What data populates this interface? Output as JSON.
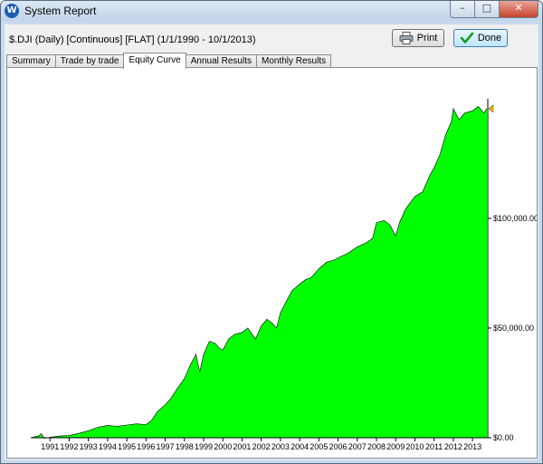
{
  "window": {
    "title": "System Report",
    "app_icon": "W",
    "controls": {
      "minimize": "–",
      "maximize": "□",
      "close": "✕"
    }
  },
  "header": {
    "subtitle": "$.DJI (Daily) [Continuous] [FLAT]  (1/1/1990 - 10/1/2013)"
  },
  "toolbar": {
    "print_label": "Print",
    "done_label": "Done"
  },
  "tabs": [
    {
      "label": "Summary"
    },
    {
      "label": "Trade by trade"
    },
    {
      "label": "Equity Curve",
      "active": true
    },
    {
      "label": "Annual Results"
    },
    {
      "label": "Monthly Results"
    }
  ],
  "colors": {
    "fill": "#00ff00",
    "outline": "#000000",
    "marker": "#e0c000"
  },
  "chart_data": {
    "type": "area",
    "x_ticks": [
      "1991",
      "1992",
      "1993",
      "1994",
      "1995",
      "1996",
      "1997",
      "1998",
      "1999",
      "2000",
      "2001",
      "2002",
      "2003",
      "2004",
      "2005",
      "2006",
      "2007",
      "2008",
      "2009",
      "2010",
      "2011",
      "2012",
      "2013"
    ],
    "y_ticks": [
      {
        "value": 0,
        "label": "$0.00"
      },
      {
        "value": 50000,
        "label": "$50,000.00"
      },
      {
        "value": 100000,
        "label": "$100,000.00"
      }
    ],
    "ylim": [
      0,
      152000
    ],
    "xlim": [
      1990.0,
      2013.75
    ],
    "series": [
      {
        "points": [
          [
            1990.0,
            0
          ],
          [
            1990.4,
            800
          ],
          [
            1990.55,
            1800
          ],
          [
            1990.7,
            -300
          ],
          [
            1991.0,
            200
          ],
          [
            1991.5,
            800
          ],
          [
            1992.0,
            1000
          ],
          [
            1992.5,
            2000
          ],
          [
            1993.0,
            3200
          ],
          [
            1993.5,
            4800
          ],
          [
            1994.0,
            5600
          ],
          [
            1994.5,
            5200
          ],
          [
            1995.0,
            5800
          ],
          [
            1995.5,
            6300
          ],
          [
            1996.0,
            6000
          ],
          [
            1996.3,
            8000
          ],
          [
            1996.6,
            12000
          ],
          [
            1997.0,
            15000
          ],
          [
            1997.3,
            18000
          ],
          [
            1997.6,
            22000
          ],
          [
            1998.0,
            27000
          ],
          [
            1998.3,
            33000
          ],
          [
            1998.6,
            38000
          ],
          [
            1998.8,
            30000
          ],
          [
            1999.0,
            38000
          ],
          [
            1999.3,
            44000
          ],
          [
            1999.6,
            43000
          ],
          [
            1999.8,
            41000
          ],
          [
            2000.0,
            40000
          ],
          [
            2000.3,
            45000
          ],
          [
            2000.6,
            47000
          ],
          [
            2001.0,
            48000
          ],
          [
            2001.3,
            50000
          ],
          [
            2001.7,
            45000
          ],
          [
            2002.0,
            51000
          ],
          [
            2002.3,
            54000
          ],
          [
            2002.6,
            52000
          ],
          [
            2002.8,
            50000
          ],
          [
            2003.0,
            57000
          ],
          [
            2003.3,
            62000
          ],
          [
            2003.6,
            67000
          ],
          [
            2004.0,
            70000
          ],
          [
            2004.3,
            72000
          ],
          [
            2004.6,
            73000
          ],
          [
            2005.0,
            77000
          ],
          [
            2005.4,
            80000
          ],
          [
            2005.8,
            81000
          ],
          [
            2006.0,
            82000
          ],
          [
            2006.5,
            84000
          ],
          [
            2007.0,
            87000
          ],
          [
            2007.5,
            89000
          ],
          [
            2007.8,
            91000
          ],
          [
            2008.0,
            98000
          ],
          [
            2008.4,
            99000
          ],
          [
            2008.7,
            97000
          ],
          [
            2009.0,
            92000
          ],
          [
            2009.2,
            98000
          ],
          [
            2009.5,
            104000
          ],
          [
            2010.0,
            110000
          ],
          [
            2010.4,
            112000
          ],
          [
            2010.8,
            120000
          ],
          [
            2011.0,
            123000
          ],
          [
            2011.3,
            129000
          ],
          [
            2011.6,
            138000
          ],
          [
            2011.9,
            144000
          ],
          [
            2012.0,
            150000
          ],
          [
            2012.3,
            145000
          ],
          [
            2012.6,
            148000
          ],
          [
            2013.0,
            149000
          ],
          [
            2013.3,
            151000
          ],
          [
            2013.6,
            148000
          ],
          [
            2013.75,
            150000
          ]
        ]
      }
    ]
  }
}
